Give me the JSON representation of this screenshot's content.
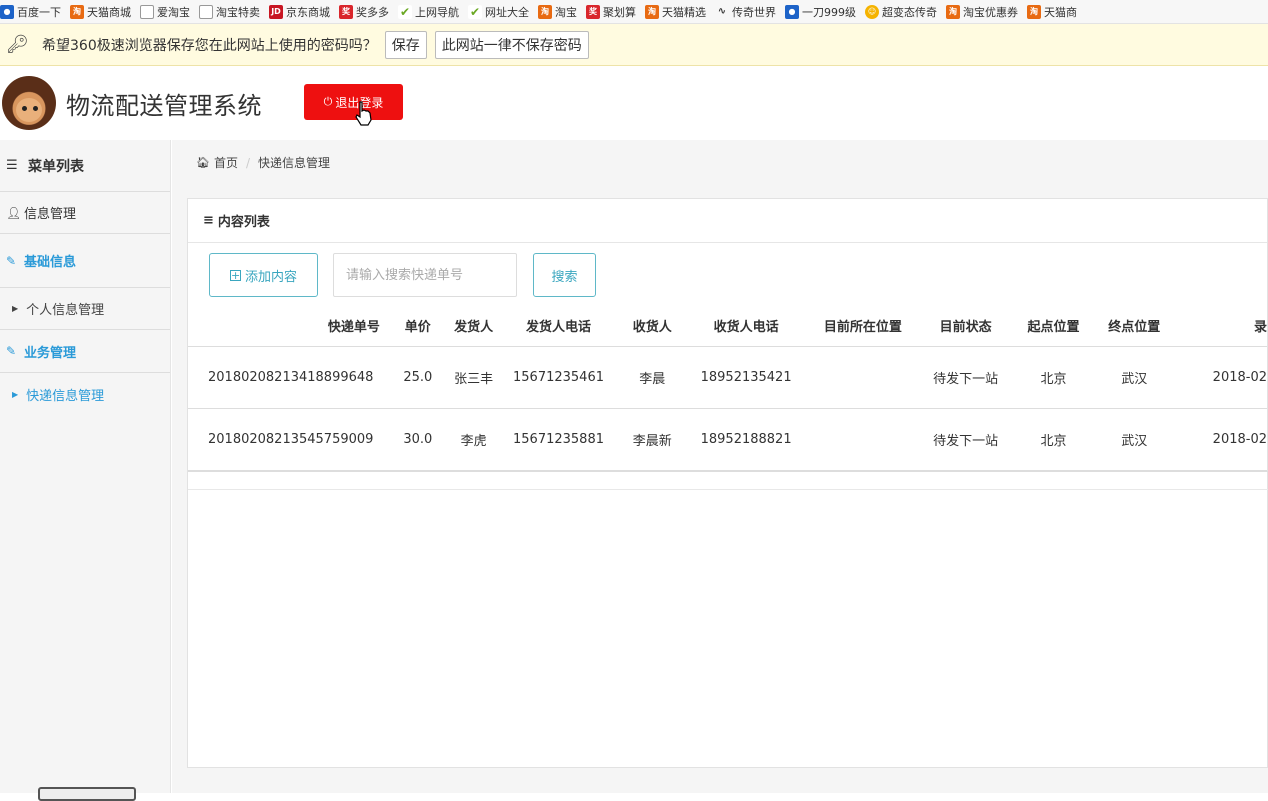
{
  "bookmarks": [
    {
      "icon": "baidu-icon",
      "label": "百度一下",
      "cls": "blue"
    },
    {
      "icon": "taobao-icon",
      "label": "天猫商城",
      "cls": "tm"
    },
    {
      "icon": "page-icon",
      "label": "爱淘宝",
      "cls": "doc"
    },
    {
      "icon": "page-icon",
      "label": "淘宝特卖",
      "cls": "doc"
    },
    {
      "icon": "jd-icon",
      "label": "京东商城",
      "cls": "jd"
    },
    {
      "icon": "jiang-icon",
      "label": "奖多多",
      "cls": "red"
    },
    {
      "icon": "nav-icon",
      "label": "上网导航",
      "cls": "grn"
    },
    {
      "icon": "nav-icon",
      "label": "网址大全",
      "cls": "grn"
    },
    {
      "icon": "taobao-icon",
      "label": "淘宝",
      "cls": "tm"
    },
    {
      "icon": "ju-icon",
      "label": "聚划算",
      "cls": "red"
    },
    {
      "icon": "taobao-icon",
      "label": "天猫精选",
      "cls": "tm"
    },
    {
      "icon": "wave-icon",
      "label": "传奇世界",
      "cls": "wave"
    },
    {
      "icon": "game-icon",
      "label": "一刀999级",
      "cls": "blue"
    },
    {
      "icon": "smile-icon",
      "label": "超变态传奇",
      "cls": "yel"
    },
    {
      "icon": "taobao-icon",
      "label": "淘宝优惠券",
      "cls": "tm"
    },
    {
      "icon": "taobao-icon",
      "label": "天猫商",
      "cls": "tm"
    }
  ],
  "password_bar": {
    "message": "希望360极速浏览器保存您在此网站上使用的密码吗？",
    "save_label": "保存",
    "never_label": "此网站一律不保存密码"
  },
  "header": {
    "title": "物流配送管理系统",
    "logout_label": "退出登录"
  },
  "sidebar": {
    "heading": "菜单列表",
    "info_management": "信息管理",
    "basic_info": "基础信息",
    "personal_info": "个人信息管理",
    "business": "业务管理",
    "express_info": "快递信息管理"
  },
  "breadcrumb": {
    "home": "首页",
    "current": "快递信息管理"
  },
  "panel": {
    "title": "内容列表",
    "add_label": "添加内容",
    "search_placeholder": "请输入搜索快递单号",
    "search_label": "搜索"
  },
  "table": {
    "columns": [
      "快递单号",
      "单价",
      "发货人",
      "发货人电话",
      "收货人",
      "收货人电话",
      "目前所在位置",
      "目前状态",
      "起点位置",
      "终点位置",
      "录"
    ],
    "rows": [
      [
        "20180208213418899648",
        "25.0",
        "张三丰",
        "15671235461",
        "李晨",
        "18952135421",
        "",
        "待发下一站",
        "北京",
        "武汉",
        "2018-02"
      ],
      [
        "20180208213545759009",
        "30.0",
        "李虎",
        "15671235881",
        "李晨新",
        "18952188821",
        "",
        "待发下一站",
        "北京",
        "武汉",
        "2018-02"
      ]
    ]
  },
  "colors": {
    "logout_bg": "#ee1010",
    "accent": "#2a9ad8",
    "button_border": "#5fb8c8"
  }
}
